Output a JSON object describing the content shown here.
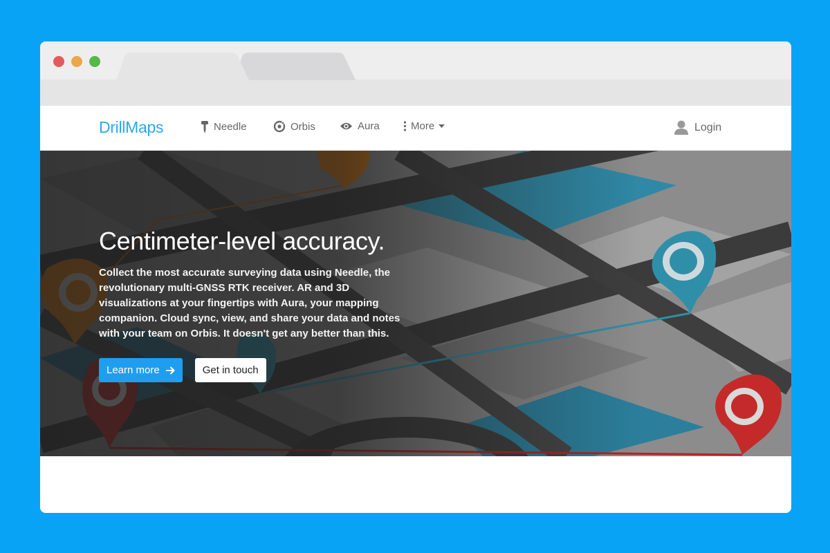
{
  "browser": {
    "tabs": [
      {
        "label": "",
        "active": true
      },
      {
        "label": "",
        "active": false
      }
    ]
  },
  "navbar": {
    "brand": "DrillMaps",
    "items": [
      {
        "label": "Needle",
        "icon": "needle-icon"
      },
      {
        "label": "Orbis",
        "icon": "orbis-icon"
      },
      {
        "label": "Aura",
        "icon": "eye-icon"
      },
      {
        "label": "More",
        "icon": "vertical-dots-icon"
      }
    ],
    "login": "Login"
  },
  "hero": {
    "title": "Centimeter-level accuracy.",
    "text": "Collect the most accurate surveying data using Needle, the revolutionary multi-GNSS RTK receiver. AR and 3D visualizations at your fingertips with Aura, your mapping companion. Cloud sync, view, and share your data and notes with your team on Orbis. It doesn't get any better than this.",
    "primary_button": "Learn more",
    "secondary_button": "Get in touch"
  },
  "colors": {
    "page_background": "#09a3f6",
    "brand": "#29a8ec",
    "primary_button": "#1f9ef0",
    "pin_teal": "#2f8fa8",
    "pin_red": "#c42a2a",
    "pin_orange": "#d9780f"
  }
}
